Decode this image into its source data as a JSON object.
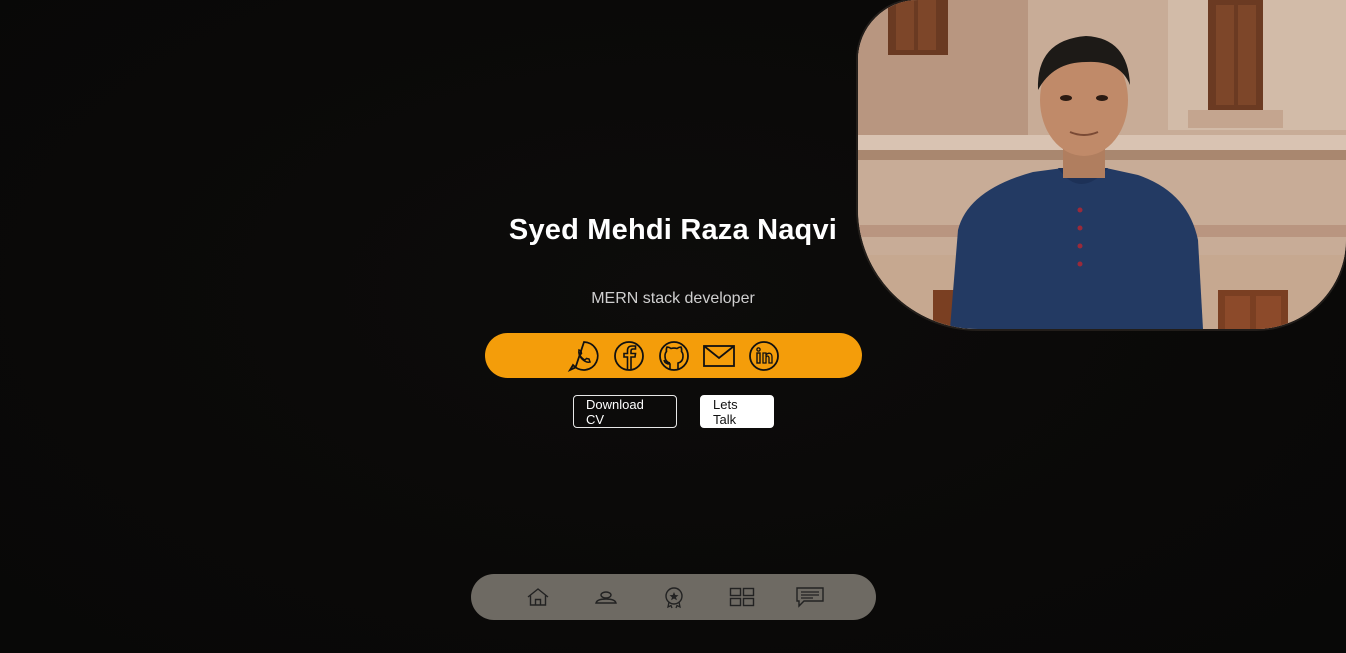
{
  "profile": {
    "name": "Syed Mehdi Raza Naqvi",
    "role": "MERN stack developer"
  },
  "social": [
    {
      "icon": "whatsapp-icon"
    },
    {
      "icon": "facebook-icon"
    },
    {
      "icon": "github-icon"
    },
    {
      "icon": "mail-icon"
    },
    {
      "icon": "linkedin-icon"
    }
  ],
  "buttons": {
    "download_cv": "Download CV",
    "lets_talk": "Lets Talk"
  },
  "nav": [
    {
      "icon": "home-icon"
    },
    {
      "icon": "user-icon"
    },
    {
      "icon": "badge-icon"
    },
    {
      "icon": "grid-icon"
    },
    {
      "icon": "message-icon"
    }
  ],
  "colors": {
    "accent": "#f49d0a",
    "background": "#0b0a09",
    "nav_bg": "#6e6a63"
  }
}
